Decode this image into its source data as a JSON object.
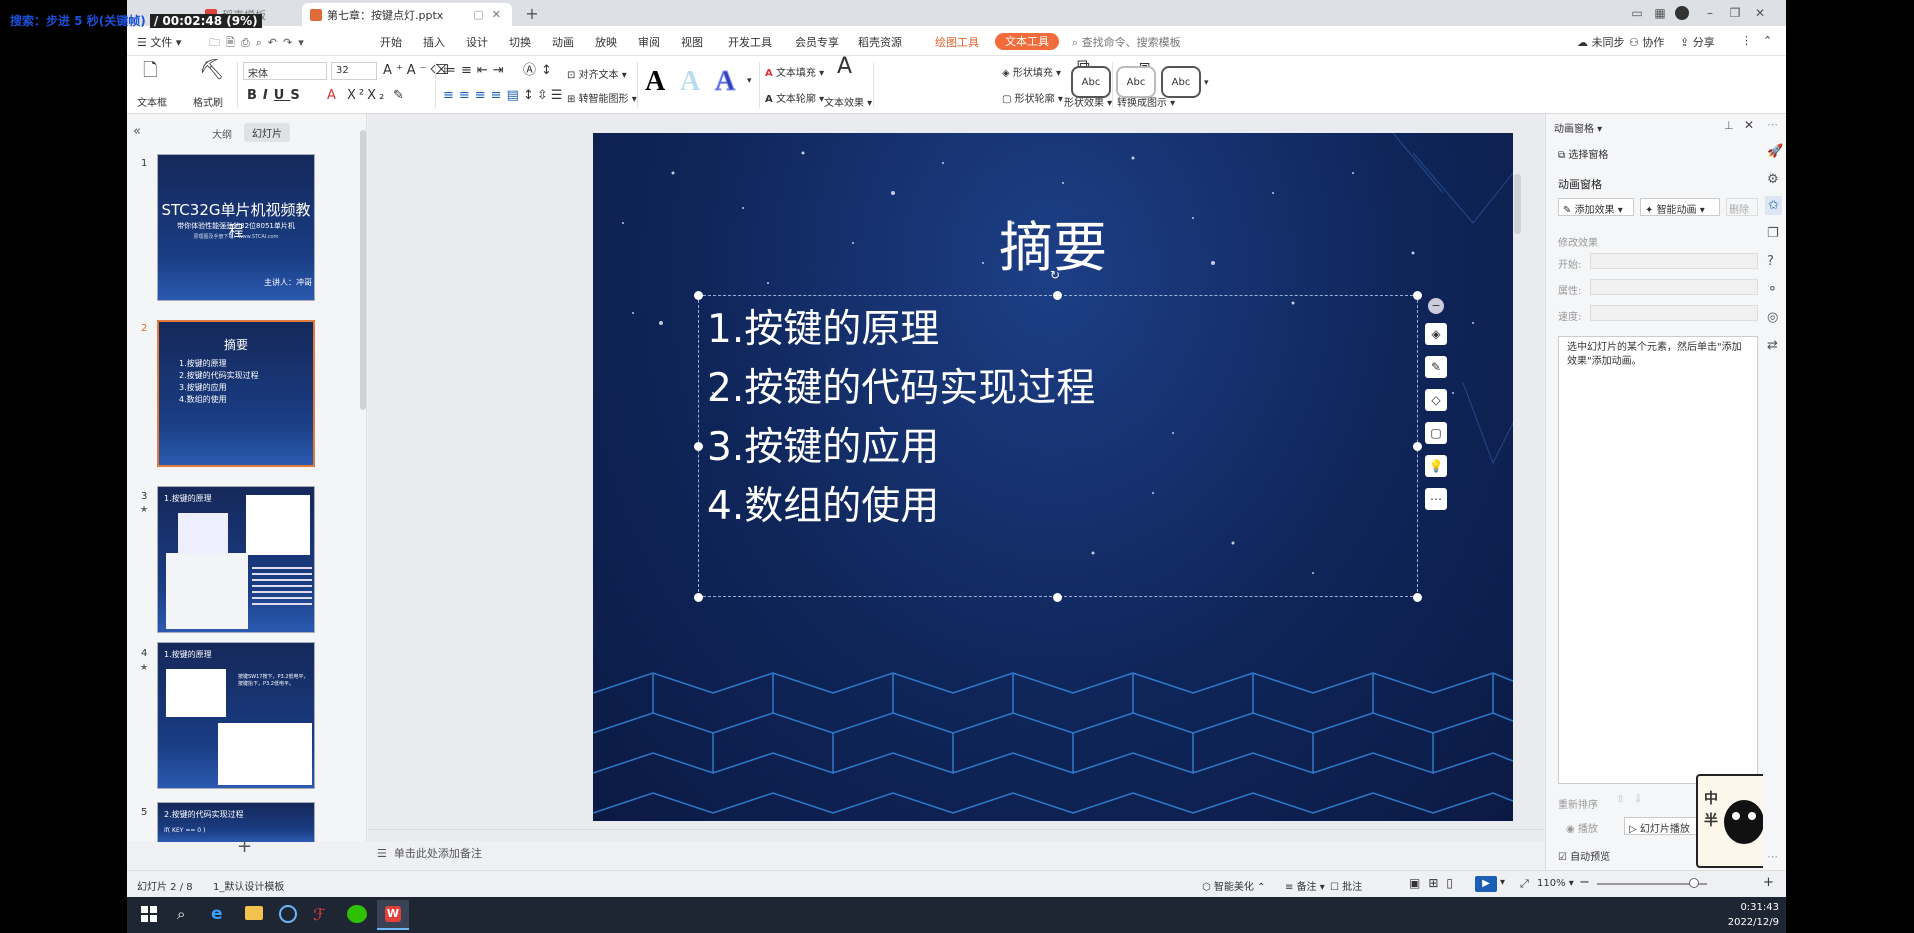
{
  "overlay": {
    "search_text": "搜索：步进 5 秒(关键帧)",
    "timer": "/ 00:02:48 (9%)"
  },
  "titlebar": {
    "tab1": "稻壳模板",
    "tab2": "第七章：按键点灯.pptx"
  },
  "menubar": {
    "file": "文件",
    "items": [
      "开始",
      "插入",
      "设计",
      "切换",
      "动画",
      "放映",
      "审阅",
      "视图",
      "开发工具",
      "会员专享",
      "稻壳资源"
    ],
    "tool1": "绘图工具",
    "tool2": "文本工具",
    "search": "查找命令、搜索模板",
    "sync": "未同步",
    "collab": "协作",
    "share": "分享"
  },
  "ribbon": {
    "textbox": "文本框",
    "format_painter": "格式刷",
    "font": "宋体",
    "size": "32",
    "align_text": "对齐文本",
    "smart_shape": "转智能图形",
    "text_fill": "文本填充",
    "text_outline": "文本轮廓",
    "text_effect": "文本效果",
    "shape_fill": "形状填充",
    "shape_outline": "形状轮廓",
    "shape_effect": "形状效果",
    "convert": "转换成图示",
    "style_abc": "Abc"
  },
  "thumbs": {
    "tab_outline": "大纲",
    "tab_slides": "幻灯片",
    "s1_title": "STC32G单片机视频教程",
    "s1_sub": "带你体验性能强劲的32位8051单片机",
    "s1_url": "原理图及手册下载：www.STCAI.com",
    "s1_speaker": "主讲人：冲哥",
    "s2_title": "摘要",
    "s2_items": [
      "1.按键的原理",
      "2.按键的代码实现过程",
      "3.按键的应用",
      "4.数组的使用"
    ],
    "s3_title": "1.按键的原理",
    "s4_title": "1.按键的原理",
    "s5_title": "2.按键的代码实现过程",
    "s4_text": "按键SW17按下，P3.2低电平，按键抬下，P3.2低电平。",
    "s5_line": "if( KEY == 0 )"
  },
  "slide": {
    "title": "摘要",
    "items": [
      "1.按键的原理",
      "2.按键的代码实现过程",
      "3.按键的应用",
      "4.数组的使用"
    ]
  },
  "animpane": {
    "title": "动画窗格",
    "select": "选择窗格",
    "section": "动画窗格",
    "add_effect": "添加效果",
    "smart_anim": "智能动画",
    "delete": "删除",
    "modify": "修改效果",
    "start": "开始:",
    "property": "属性:",
    "speed": "速度:",
    "hint": "选中幻灯片的某个元素，然后单击\"添加效果\"添加动画。",
    "reorder": "重新排序",
    "play": "播放",
    "slideshow": "幻灯片播放",
    "autopreview": "自动预览"
  },
  "notes": "单击此处添加备注",
  "status": {
    "slide": "幻灯片 2 / 8",
    "template": "1_默认设计模板",
    "beautify": "智能美化",
    "notes": "备注",
    "comment": "批注",
    "zoom": "110%"
  },
  "taskbar": {
    "time": "0:31:43",
    "date": "2022/12/9"
  },
  "sticker_text": "中半"
}
